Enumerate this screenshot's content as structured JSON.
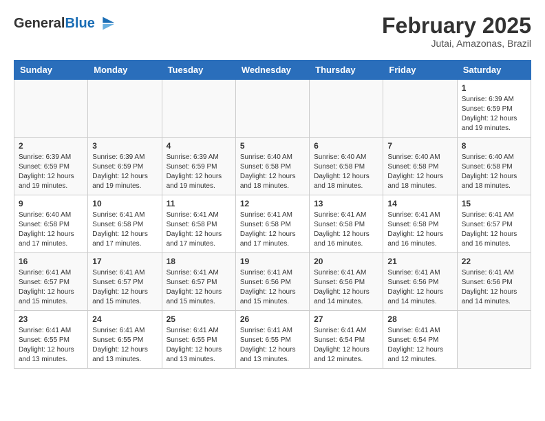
{
  "header": {
    "logo_general": "General",
    "logo_blue": "Blue",
    "title": "February 2025",
    "subtitle": "Jutai, Amazonas, Brazil"
  },
  "calendar": {
    "days_of_week": [
      "Sunday",
      "Monday",
      "Tuesday",
      "Wednesday",
      "Thursday",
      "Friday",
      "Saturday"
    ],
    "weeks": [
      [
        {
          "day": "",
          "info": ""
        },
        {
          "day": "",
          "info": ""
        },
        {
          "day": "",
          "info": ""
        },
        {
          "day": "",
          "info": ""
        },
        {
          "day": "",
          "info": ""
        },
        {
          "day": "",
          "info": ""
        },
        {
          "day": "1",
          "info": "Sunrise: 6:39 AM\nSunset: 6:59 PM\nDaylight: 12 hours\nand 19 minutes."
        }
      ],
      [
        {
          "day": "2",
          "info": "Sunrise: 6:39 AM\nSunset: 6:59 PM\nDaylight: 12 hours\nand 19 minutes."
        },
        {
          "day": "3",
          "info": "Sunrise: 6:39 AM\nSunset: 6:59 PM\nDaylight: 12 hours\nand 19 minutes."
        },
        {
          "day": "4",
          "info": "Sunrise: 6:39 AM\nSunset: 6:59 PM\nDaylight: 12 hours\nand 19 minutes."
        },
        {
          "day": "5",
          "info": "Sunrise: 6:40 AM\nSunset: 6:58 PM\nDaylight: 12 hours\nand 18 minutes."
        },
        {
          "day": "6",
          "info": "Sunrise: 6:40 AM\nSunset: 6:58 PM\nDaylight: 12 hours\nand 18 minutes."
        },
        {
          "day": "7",
          "info": "Sunrise: 6:40 AM\nSunset: 6:58 PM\nDaylight: 12 hours\nand 18 minutes."
        },
        {
          "day": "8",
          "info": "Sunrise: 6:40 AM\nSunset: 6:58 PM\nDaylight: 12 hours\nand 18 minutes."
        }
      ],
      [
        {
          "day": "9",
          "info": "Sunrise: 6:40 AM\nSunset: 6:58 PM\nDaylight: 12 hours\nand 17 minutes."
        },
        {
          "day": "10",
          "info": "Sunrise: 6:41 AM\nSunset: 6:58 PM\nDaylight: 12 hours\nand 17 minutes."
        },
        {
          "day": "11",
          "info": "Sunrise: 6:41 AM\nSunset: 6:58 PM\nDaylight: 12 hours\nand 17 minutes."
        },
        {
          "day": "12",
          "info": "Sunrise: 6:41 AM\nSunset: 6:58 PM\nDaylight: 12 hours\nand 17 minutes."
        },
        {
          "day": "13",
          "info": "Sunrise: 6:41 AM\nSunset: 6:58 PM\nDaylight: 12 hours\nand 16 minutes."
        },
        {
          "day": "14",
          "info": "Sunrise: 6:41 AM\nSunset: 6:58 PM\nDaylight: 12 hours\nand 16 minutes."
        },
        {
          "day": "15",
          "info": "Sunrise: 6:41 AM\nSunset: 6:57 PM\nDaylight: 12 hours\nand 16 minutes."
        }
      ],
      [
        {
          "day": "16",
          "info": "Sunrise: 6:41 AM\nSunset: 6:57 PM\nDaylight: 12 hours\nand 15 minutes."
        },
        {
          "day": "17",
          "info": "Sunrise: 6:41 AM\nSunset: 6:57 PM\nDaylight: 12 hours\nand 15 minutes."
        },
        {
          "day": "18",
          "info": "Sunrise: 6:41 AM\nSunset: 6:57 PM\nDaylight: 12 hours\nand 15 minutes."
        },
        {
          "day": "19",
          "info": "Sunrise: 6:41 AM\nSunset: 6:56 PM\nDaylight: 12 hours\nand 15 minutes."
        },
        {
          "day": "20",
          "info": "Sunrise: 6:41 AM\nSunset: 6:56 PM\nDaylight: 12 hours\nand 14 minutes."
        },
        {
          "day": "21",
          "info": "Sunrise: 6:41 AM\nSunset: 6:56 PM\nDaylight: 12 hours\nand 14 minutes."
        },
        {
          "day": "22",
          "info": "Sunrise: 6:41 AM\nSunset: 6:56 PM\nDaylight: 12 hours\nand 14 minutes."
        }
      ],
      [
        {
          "day": "23",
          "info": "Sunrise: 6:41 AM\nSunset: 6:55 PM\nDaylight: 12 hours\nand 13 minutes."
        },
        {
          "day": "24",
          "info": "Sunrise: 6:41 AM\nSunset: 6:55 PM\nDaylight: 12 hours\nand 13 minutes."
        },
        {
          "day": "25",
          "info": "Sunrise: 6:41 AM\nSunset: 6:55 PM\nDaylight: 12 hours\nand 13 minutes."
        },
        {
          "day": "26",
          "info": "Sunrise: 6:41 AM\nSunset: 6:55 PM\nDaylight: 12 hours\nand 13 minutes."
        },
        {
          "day": "27",
          "info": "Sunrise: 6:41 AM\nSunset: 6:54 PM\nDaylight: 12 hours\nand 12 minutes."
        },
        {
          "day": "28",
          "info": "Sunrise: 6:41 AM\nSunset: 6:54 PM\nDaylight: 12 hours\nand 12 minutes."
        },
        {
          "day": "",
          "info": ""
        }
      ]
    ]
  }
}
